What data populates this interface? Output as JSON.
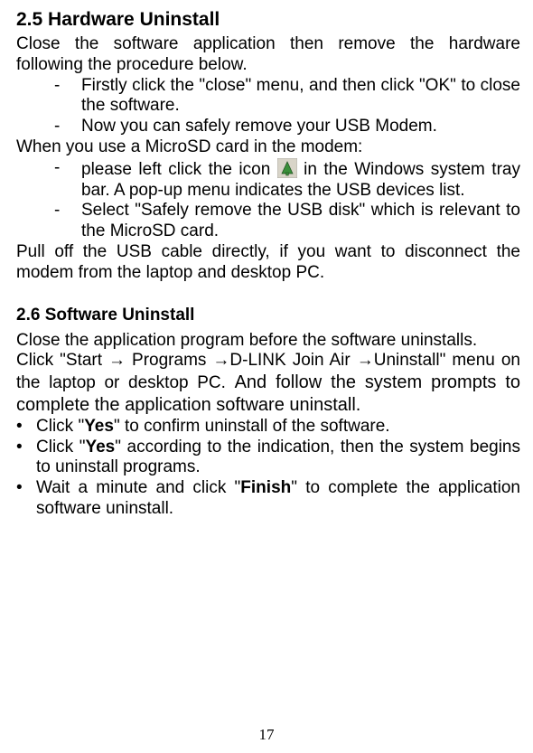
{
  "section25": {
    "heading": "2.5 Hardware Uninstall",
    "intro": "Close the software application then remove the hardware following the procedure below.",
    "item1": "Firstly click the \"close\" menu, and then click \"OK\" to close the software.",
    "item2": "Now you can safely remove your USB Modem.",
    "midline": "When you use a MicroSD card in the modem:",
    "item3a": "please left click the icon ",
    "item3b": " in the Windows system tray bar. A pop-up menu indicates the USB devices list.",
    "item4": "Select \"Safely remove the USB disk\" which is relevant to the MicroSD card.",
    "outro": "Pull off the USB cable directly, if you want to disconnect the modem from the laptop and desktop PC.",
    "icon_name": "safely-remove-hardware-tray-icon"
  },
  "section26": {
    "heading": "2.6 Software Uninstall",
    "line1": "Close the application program before the software uninstalls.",
    "line2a": "Click \"Start → Programs →D-LINK Join Air →Uninstall\" menu on the laptop or desktop PC. ",
    "line2b": "And follow the system prompts to complete the application software uninstall.",
    "b1a": "Click \"",
    "b1bold": "Yes",
    "b1b": "\" to confirm uninstall of the software.",
    "b2a": "Click \"",
    "b2bold": "Yes",
    "b2b": "\" according to the indication, then the system begins to uninstall programs.",
    "b3a": "Wait a minute and click \"",
    "b3bold": "Finish",
    "b3b": "\" to complete the application software uninstall."
  },
  "page_number": "17"
}
